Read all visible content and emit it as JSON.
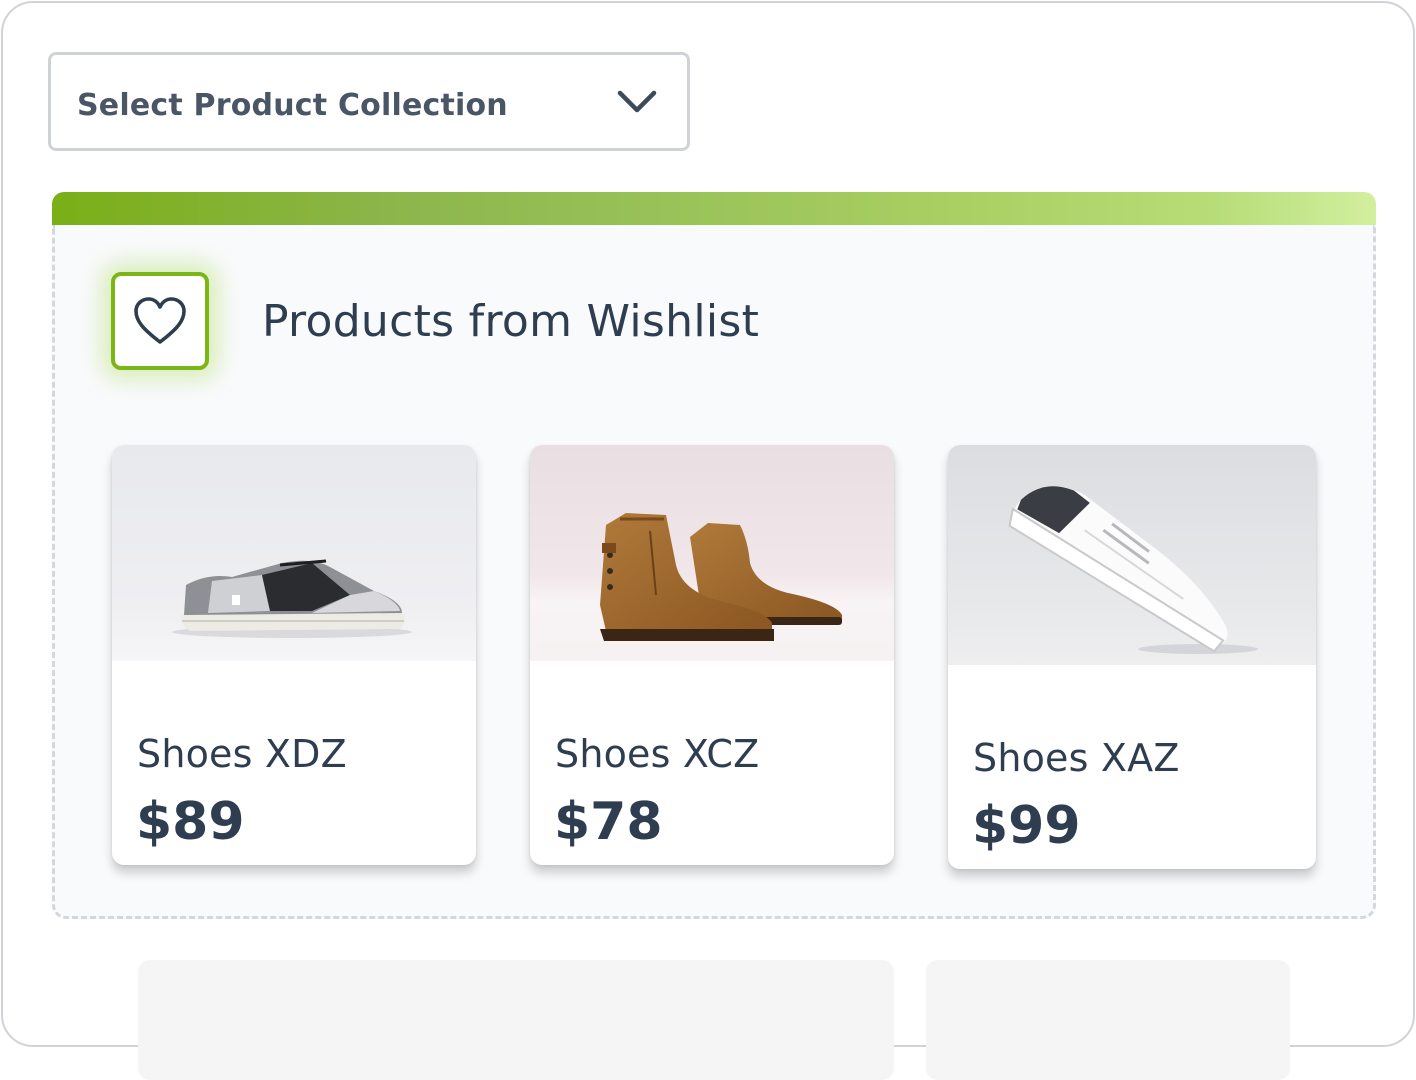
{
  "collection_select": {
    "selected": "Select Product Collection",
    "chevron_icon": "chevron-down-icon"
  },
  "wishlist_section": {
    "title": "Products from Wishlist",
    "icon": "heart-icon",
    "accent_color": "#7cb516"
  },
  "products": [
    {
      "name": "Shoes XDZ",
      "price": "$89"
    },
    {
      "name": "Shoes XCZ",
      "price": "$78"
    },
    {
      "name": "Shoes XAZ",
      "price": "$99"
    }
  ]
}
